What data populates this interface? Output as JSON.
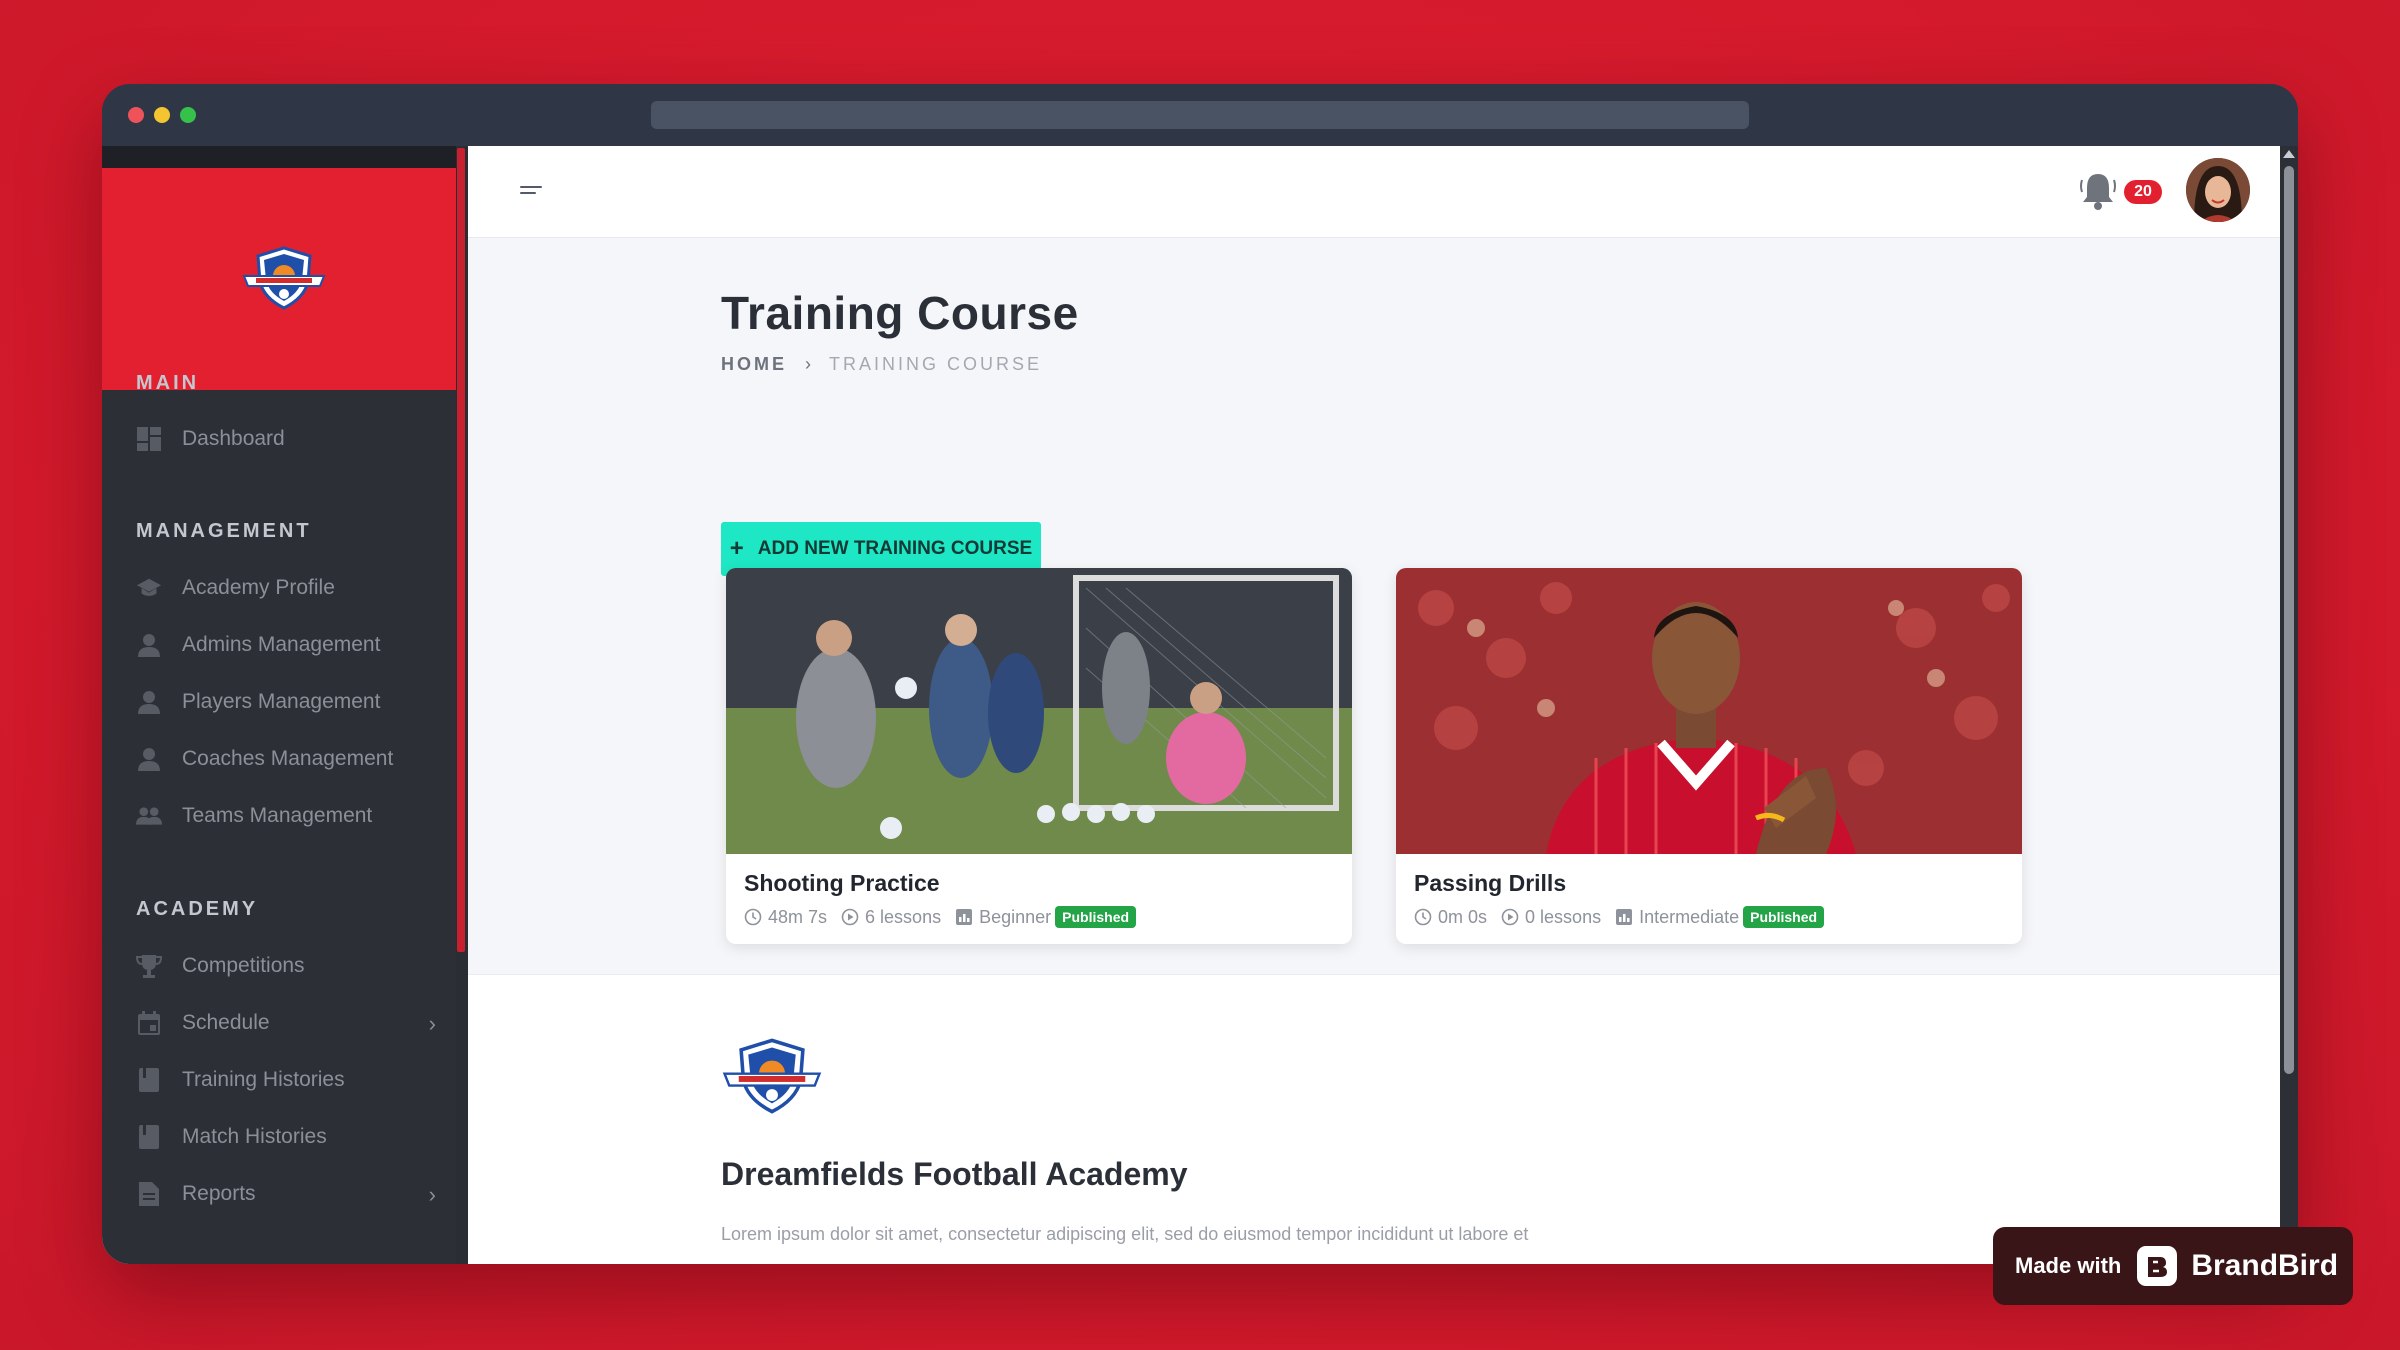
{
  "sidebar": {
    "sections": [
      {
        "title": "MAIN"
      },
      {
        "title": "MANAGEMENT"
      },
      {
        "title": "ACADEMY"
      }
    ],
    "items": [
      {
        "label": "Dashboard",
        "icon": "dashboard-icon"
      },
      {
        "label": "Academy Profile",
        "icon": "graduation-cap-icon"
      },
      {
        "label": "Admins Management",
        "icon": "user-icon"
      },
      {
        "label": "Players Management",
        "icon": "user-icon"
      },
      {
        "label": "Coaches Management",
        "icon": "user-icon"
      },
      {
        "label": "Teams Management",
        "icon": "users-icon"
      },
      {
        "label": "Competitions",
        "icon": "trophy-icon"
      },
      {
        "label": "Schedule",
        "icon": "calendar-icon",
        "has_submenu": true
      },
      {
        "label": "Training Histories",
        "icon": "book-icon"
      },
      {
        "label": "Match Histories",
        "icon": "book-icon"
      },
      {
        "label": "Reports",
        "icon": "document-icon",
        "has_submenu": true
      }
    ]
  },
  "header": {
    "notification_count": "20"
  },
  "page": {
    "title": "Training Course",
    "breadcrumb": {
      "home": "HOME",
      "current": "TRAINING COURSE"
    },
    "add_button_label": "ADD NEW TRAINING COURSE"
  },
  "courses": [
    {
      "title": "Shooting Practice",
      "duration": "48m 7s",
      "lessons": "6 lessons",
      "level": "Beginner",
      "status": "Published"
    },
    {
      "title": "Passing Drills",
      "duration": "0m 0s",
      "lessons": "0 lessons",
      "level": "Intermediate",
      "status": "Published"
    }
  ],
  "footer": {
    "academy_name": "Dreamfields Football Academy",
    "description": "Lorem ipsum dolor sit amet, consectetur adipiscing elit, sed do eiusmod tempor incididunt ut labore et"
  },
  "promo": {
    "made_with": "Made with",
    "brand": "BrandBird"
  },
  "colors": {
    "background": "#d91a2e",
    "brand_red": "#e3202f",
    "sidebar": "#2c2f36",
    "accent_teal": "#1de7c4",
    "published_green": "#22a447"
  }
}
